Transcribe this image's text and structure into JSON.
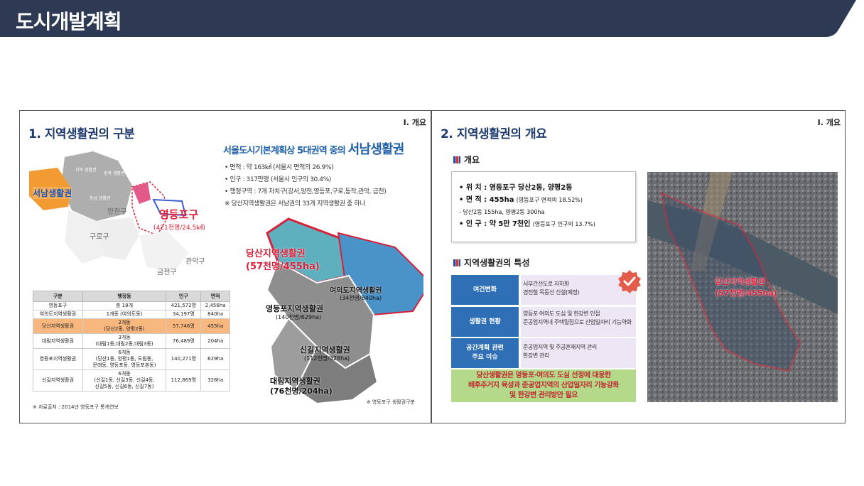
{
  "header": {
    "title": "도시개발계획",
    "bar_color": "#2e3a53"
  },
  "slide1": {
    "section_tag": "Ⅰ. 개요",
    "title": "1. 지역생활권의 구분",
    "map": {
      "highlight_region": "서남생활권",
      "target_name": "영등포구",
      "target_stats": "(421천명/24.5㎢)",
      "labels": [
        "양천구",
        "구로구",
        "금천구",
        "관악구",
        "동작구"
      ]
    },
    "headline_prefix": "서울도시기본계획상 5대권역 중의",
    "headline_main": "서남생활권",
    "bullets": [
      "• 면적 : 약 163㎢ (서울시 면적의 26.9%)",
      "• 인구 : 317만명 (서울시 인구의 30.4%)",
      "• 행정구역 : 7개 자치구(강서,양천,영등포,구로,동작,관악, 금천)",
      "※  당산지역생활권은 서남권의 33개 지역생활권 중 하나"
    ],
    "table": {
      "headers": [
        "구분",
        "행정동",
        "인구",
        "면적"
      ],
      "rows": [
        [
          "영등포구",
          "총 18개",
          "421,572명",
          "2,456ha"
        ],
        [
          "여의도지역생활권",
          "1개동 (여의도동)",
          "34,197명",
          "840ha"
        ],
        [
          "당산지역생활권",
          "2개동\n(당산2동, 양평2동)",
          "57,746명",
          "455ha"
        ],
        [
          "대림지역생활권",
          "3개동\n(대림1동,대림2동,대림3동)",
          "76,489명",
          "204ha"
        ],
        [
          "영등포지역생활권",
          "6개동\n(당산1동, 양평1동, 도림동,\n문래동, 영등포동, 영등포본동)",
          "140,271명",
          "629ha"
        ],
        [
          "신길지역생활권",
          "6개동\n(신길1동, 신길3동, 신길4동,\n신길5동, 신길6동, 신길7동)",
          "112,869명",
          "328ha"
        ]
      ],
      "highlight_row": 2
    },
    "source": "※ 자료출처 : 2014년 영등포구 통계연보",
    "districts": [
      {
        "name": "당산지역생활권",
        "stats": "(57천명/455ha)"
      },
      {
        "name": "여의도지역생활권",
        "stats": "(34천명/840ha)"
      },
      {
        "name": "영등포지역생활권",
        "stats": "(140천명/629ha)"
      },
      {
        "name": "신길지역생활권",
        "stats": "(112천명/328ha)"
      },
      {
        "name": "대림지역생활권",
        "stats": "(76천명/204ha)"
      }
    ],
    "map_note": "※ 영등포구 생활권구분"
  },
  "slide2": {
    "section_tag": "Ⅰ. 개요",
    "title": "2. 지역생활권의 개요",
    "overview_head": "개요",
    "overview": {
      "location": "• 위  치 : 영등포구 당산2동, 양평2동",
      "area_main": "• 면  적 : 455ha",
      "area_note": "(영등포구 면적의 18.52%)",
      "area_detail": "- 당산2동 155ha, 양평2동 300ha",
      "pop_main": "• 인  구 : 약 5만 7천인",
      "pop_note": "(영등포구 인구의 13.7%)"
    },
    "features_head": "지역생활권의 특성",
    "features": [
      {
        "label": "여건변화",
        "desc": "서부간선도로 지하화\n경전철 목동선 신설(예정)"
      },
      {
        "label": "생활권 현황",
        "desc": "영등포·여의도 도심 및 한강변 인접\n준공업지역내 주택밀집으로 산업일자리 기능약화"
      },
      {
        "label": "공간계획 관련\n주요 이슈",
        "desc": "준공업지역 및 주공혼재지역 관리\n한강변 관리"
      }
    ],
    "summary": "당산생활권은 영등포·여의도 도심 선정에 대응한\n배후주거지 육성과 준공업지역의 산업일자리 기능강화\n및 한강변 관리방안 필요",
    "photo_label_name": "당산지역생활권",
    "photo_label_stats": "(57천명/455ha)"
  }
}
